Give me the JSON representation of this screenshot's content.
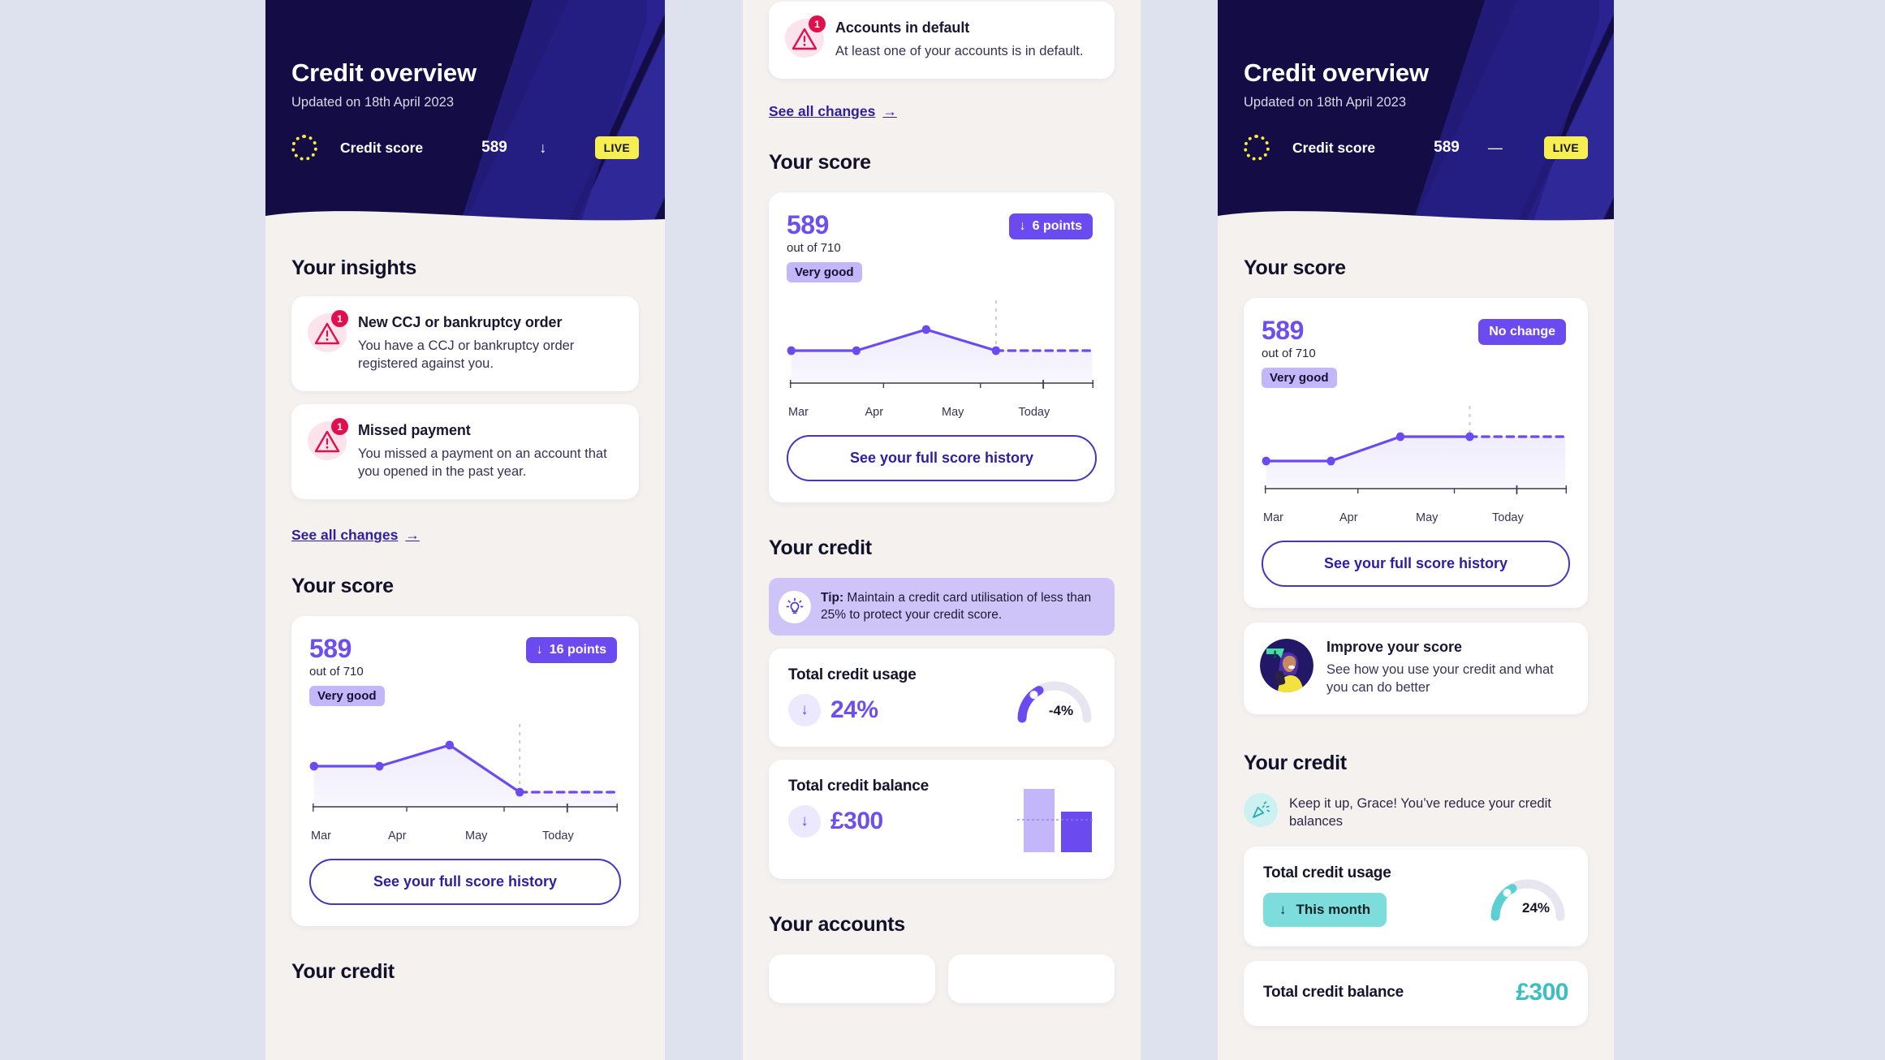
{
  "theme": {
    "page_bg": "#dee2ee",
    "panel_bg": "#f4f1ef",
    "hero_bg": "#140d45",
    "accent_purple": "#6b4bf0",
    "accent_dark_purple": "#2e1f9e",
    "accent_yellow": "#f7ef52",
    "accent_teal": "#7ddcdc",
    "alert_red": "#e0104f"
  },
  "hero": {
    "title": "Credit overview",
    "subtitle": "Updated on 18th April 2023",
    "score_label": "Credit score",
    "score_value": "589",
    "trend_down": "↓",
    "trend_flat": "—",
    "live_badge": "LIVE",
    "ring_icon": "dotted-ring-icon"
  },
  "panel1": {
    "insights_heading": "Your insights",
    "insights": [
      {
        "count": "1",
        "title": "New CCJ or bankruptcy order",
        "body": "You have a CCJ or bankruptcy order registered against you.",
        "icon": "warning-triangle-icon"
      },
      {
        "count": "1",
        "title": "Missed payment",
        "body": "You missed a payment on an account that you opened in the past year.",
        "icon": "warning-triangle-icon"
      }
    ],
    "see_all_changes": "See all changes",
    "see_all_arrow": "→",
    "score_heading": "Your score",
    "score": {
      "value": "589",
      "out_of": "out of 710",
      "rating": "Very good",
      "delta_arrow": "↓",
      "delta_label": "16 points",
      "cta": "See your full score history"
    },
    "credit_heading": "Your credit"
  },
  "panel2": {
    "alert": {
      "count": "1",
      "title": "Accounts in default",
      "body": "At least one of your accounts is in default.",
      "icon": "warning-triangle-icon"
    },
    "see_all_changes": "See all changes",
    "see_all_arrow": "→",
    "score_heading": "Your score",
    "score": {
      "value": "589",
      "out_of": "out of 710",
      "rating": "Very good",
      "delta_arrow": "↓",
      "delta_label": "6 points",
      "cta": "See your full score history"
    },
    "credit_heading": "Your credit",
    "tip": {
      "label": "Tip:",
      "text": " Maintain a credit card utilisation of less than 25% to protect your credit score.",
      "icon": "lightbulb-icon"
    },
    "usage": {
      "title": "Total credit usage",
      "dir_arrow": "↓",
      "value": "24%",
      "gauge_label": "-4%",
      "gauge_percent": 24
    },
    "balance": {
      "title": "Total credit balance",
      "dir_arrow": "↓",
      "value": "£300"
    },
    "accounts_heading": "Your accounts"
  },
  "panel3": {
    "score_heading": "Your score",
    "score": {
      "value": "589",
      "out_of": "out of 710",
      "rating": "Very good",
      "delta_label": "No change",
      "cta": "See your full score history"
    },
    "improve": {
      "title": "Improve your score",
      "body": "See how you use your credit and what you can do better",
      "icon": "avatar-illustration"
    },
    "credit_heading": "Your credit",
    "celebrate": {
      "text": "Keep it up, Grace! You’ve reduce your credit balances",
      "icon": "party-popper-icon"
    },
    "usage": {
      "title": "Total credit usage",
      "pill_arrow": "↓",
      "pill_label": "This month",
      "gauge_label": "24%",
      "gauge_percent": 24
    },
    "balance": {
      "title": "Total credit balance",
      "value": "£300"
    }
  },
  "chart_data": [
    {
      "type": "line",
      "id": "panel1-score-history",
      "title": "Your score",
      "categories": [
        "Mar",
        "Apr",
        "May",
        "Today"
      ],
      "values": [
        589,
        589,
        605,
        573
      ],
      "ylim": [
        560,
        615
      ],
      "grid": false,
      "annotation": "↓ 16 points",
      "projection_dashed": true,
      "ylabel": "",
      "xlabel": ""
    },
    {
      "type": "line",
      "id": "panel2-score-history",
      "title": "Your score",
      "categories": [
        "Mar",
        "Apr",
        "May",
        "Today"
      ],
      "values": [
        589,
        589,
        601,
        589
      ],
      "ylim": [
        575,
        610
      ],
      "grid": false,
      "annotation": "↓ 6 points",
      "projection_dashed": true,
      "ylabel": "",
      "xlabel": ""
    },
    {
      "type": "line",
      "id": "panel3-score-history",
      "title": "Your score",
      "categories": [
        "Mar",
        "Apr",
        "May",
        "Today"
      ],
      "values": [
        583,
        583,
        595,
        595
      ],
      "ylim": [
        570,
        605
      ],
      "grid": false,
      "annotation": "No change",
      "projection_dashed": true,
      "ylabel": "",
      "xlabel": ""
    },
    {
      "type": "gauge",
      "id": "panel2-credit-usage-gauge",
      "title": "Total credit usage",
      "value": 24,
      "label": "-4%",
      "max": 100,
      "color": "#6b4bf0"
    },
    {
      "type": "bar",
      "id": "panel2-credit-balance-bars",
      "title": "Total credit balance",
      "categories": [
        "Previous",
        "Current"
      ],
      "values": [
        100,
        62
      ],
      "colors": [
        "#c3b6fb",
        "#6b4bf0"
      ]
    },
    {
      "type": "gauge",
      "id": "panel3-credit-usage-gauge",
      "title": "Total credit usage",
      "value": 24,
      "label": "24%",
      "max": 100,
      "color": "#5ccfd3"
    }
  ]
}
